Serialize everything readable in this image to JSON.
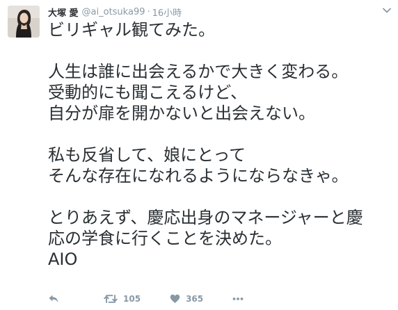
{
  "tweet": {
    "user": {
      "display_name": "大塚 愛",
      "handle": "@ai_otsuka99",
      "separator": "·",
      "timestamp": "16小時"
    },
    "text_lines": [
      "ビリギャル観てみた。",
      "",
      "人生は誰に出会えるかで大きく変わる。",
      "受動的にも聞こえるけど、",
      "自分が扉を開かないと出会えない。",
      "",
      "私も反省して、娘にとって",
      "そんな存在になれるようにならなきゃ。",
      "",
      "とりあえず、慶応出身のマネージャーと慶",
      "応の学食に行くことを決めた。",
      "AIO"
    ],
    "actions": {
      "reply_icon": "reply-icon",
      "retweet_icon": "retweet-icon",
      "retweet_count": "105",
      "like_icon": "heart-icon",
      "like_count": "365",
      "more_icon": "more-icon"
    },
    "menu_icon": "chevron-down-icon",
    "colors": {
      "text": "#292f33",
      "secondary": "#8899a6",
      "background": "#ffffff"
    }
  }
}
